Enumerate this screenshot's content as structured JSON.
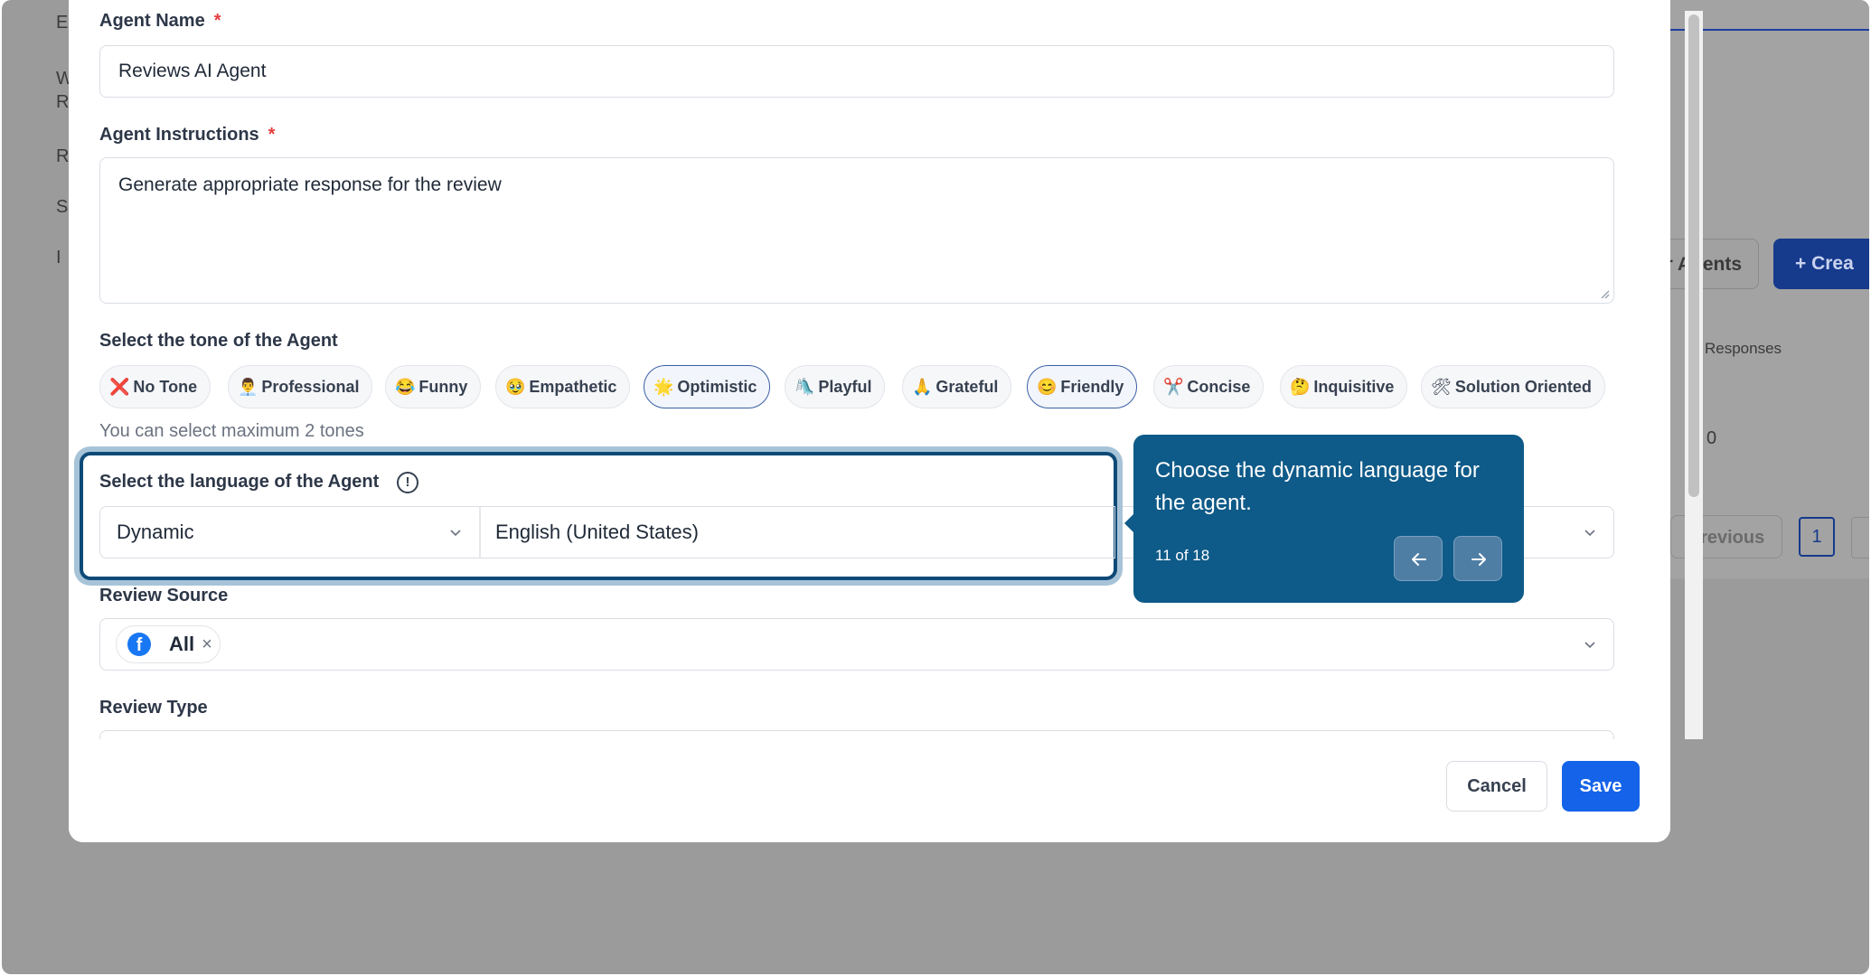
{
  "background": {
    "sidebar_fragments": [
      "E",
      "W",
      "R",
      "R",
      "S",
      "I"
    ],
    "agents_button": "r Agents",
    "create_button": "+ Crea",
    "column_header": "Responses",
    "cell_value": "0",
    "pagination": {
      "previous": "Previous",
      "page": "1"
    }
  },
  "form": {
    "agent_name": {
      "label": "Agent Name",
      "required": "*",
      "value": "Reviews AI Agent"
    },
    "instructions": {
      "label": "Agent Instructions",
      "required": "*",
      "value": "Generate appropriate response for the review"
    },
    "tone": {
      "label": "Select the tone of the Agent",
      "chips": [
        {
          "emoji": "❌",
          "label": "No Tone"
        },
        {
          "emoji": "👨‍💼",
          "label": "Professional"
        },
        {
          "emoji": "😂",
          "label": "Funny"
        },
        {
          "emoji": "🥹",
          "label": "Empathetic"
        },
        {
          "emoji": "🌟",
          "label": "Optimistic"
        },
        {
          "emoji": "🛝",
          "label": "Playful"
        },
        {
          "emoji": "🙏",
          "label": "Grateful"
        },
        {
          "emoji": "😊",
          "label": "Friendly"
        },
        {
          "emoji": "✂️",
          "label": "Concise"
        },
        {
          "emoji": "🤔",
          "label": "Inquisitive"
        },
        {
          "emoji": "🛠",
          "label": "Solution Oriented"
        }
      ],
      "hint": "You can select maximum 2 tones"
    },
    "language": {
      "label": "Select the language of the Agent",
      "info_icon": "!",
      "mode_value": "Dynamic",
      "language_value": "English (United States)"
    },
    "review_source": {
      "label": "Review Source",
      "tag": "All",
      "tag_icon": "f",
      "remove": "×"
    },
    "review_type": {
      "label": "Review Type"
    }
  },
  "tooltip": {
    "text": "Choose the dynamic language for the agent.",
    "step": "11 of 18"
  },
  "footer": {
    "cancel": "Cancel",
    "save": "Save"
  },
  "colors": {
    "primary": "#1463e8",
    "tooltip": "#0e5a88",
    "required": "#e53e3e"
  }
}
